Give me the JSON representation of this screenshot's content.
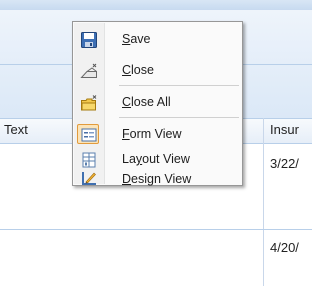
{
  "background": {
    "column_headers": [
      "Text",
      "Insur"
    ],
    "rows": [
      {
        "date": "3/22/"
      },
      {
        "date": "4/20/"
      }
    ]
  },
  "context_menu": {
    "items": [
      {
        "pre": "",
        "key": "S",
        "post": "ave",
        "icon": "save-icon"
      },
      {
        "pre": "",
        "key": "C",
        "post": "lose",
        "icon": "close-icon"
      },
      {
        "pre": "",
        "key": "C",
        "post": "lose All",
        "icon": "close-all-icon"
      },
      {
        "pre": "",
        "key": "F",
        "post": "orm View",
        "icon": "form-view-icon"
      },
      {
        "pre": "La",
        "key": "y",
        "post": "out View",
        "icon": "layout-view-icon"
      },
      {
        "pre": "",
        "key": "D",
        "post": "esign View",
        "icon": "design-view-icon"
      }
    ],
    "selected_view": "Form View"
  },
  "colors": {
    "header_blue": "#dbe8f7",
    "selection_orange": "#e29b3c"
  }
}
